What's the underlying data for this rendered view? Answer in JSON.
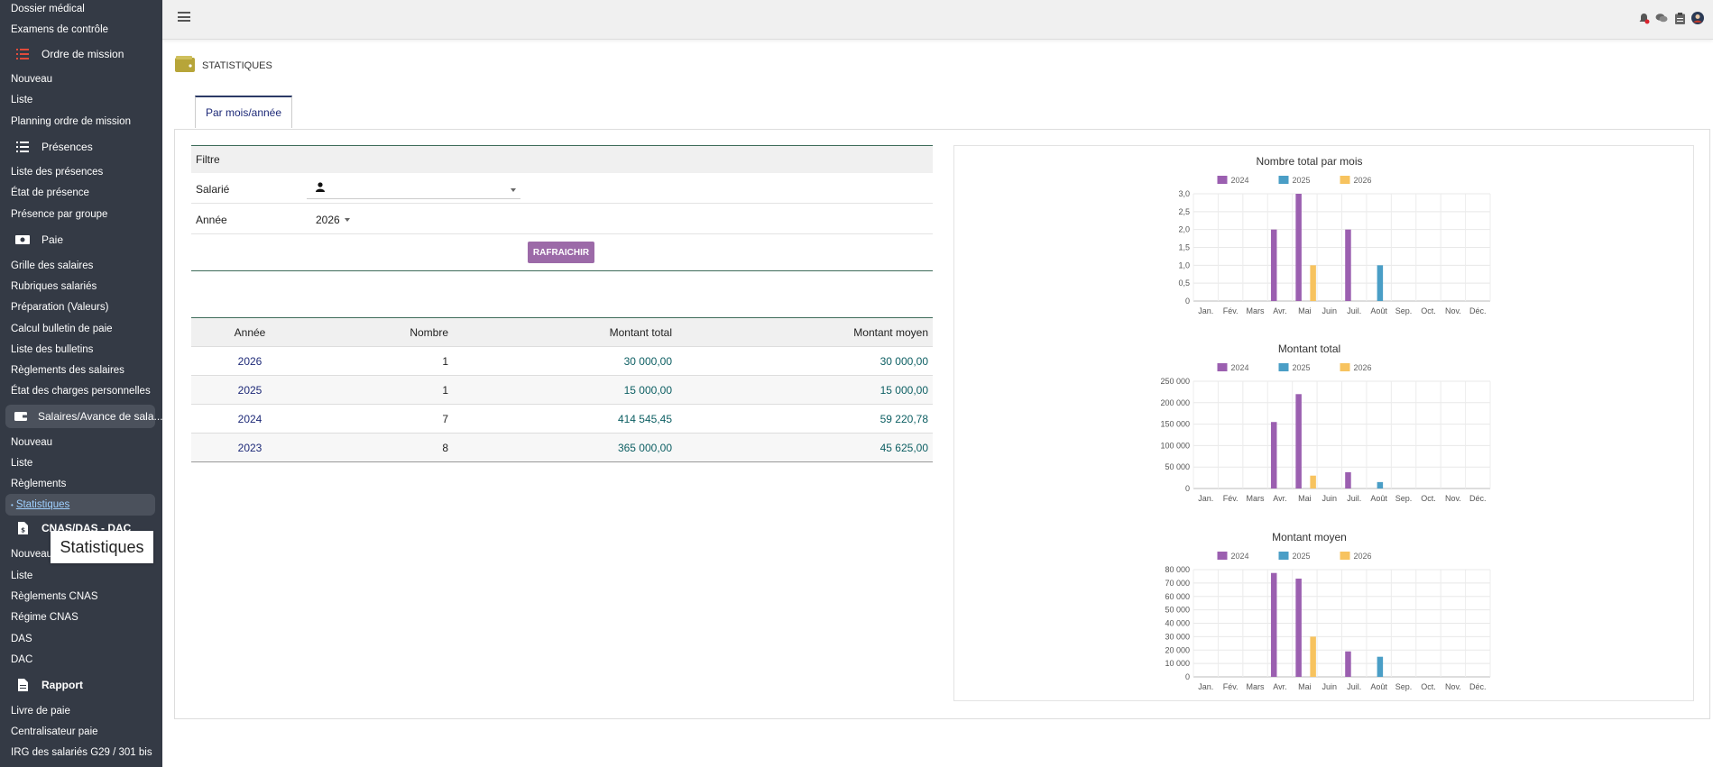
{
  "sidebar": {
    "items": [
      {
        "label": "Dossier médical",
        "type": "item"
      },
      {
        "label": "Examens de contrôle",
        "type": "item"
      },
      {
        "label": "Ordre de mission",
        "type": "section",
        "icon": "list-red-icon"
      },
      {
        "label": "Nouveau",
        "type": "item"
      },
      {
        "label": "Liste",
        "type": "item"
      },
      {
        "label": "Planning ordre de mission",
        "type": "item"
      },
      {
        "label": "Présences",
        "type": "section",
        "icon": "list-icon"
      },
      {
        "label": "Liste des présences",
        "type": "item"
      },
      {
        "label": "État de présence",
        "type": "item"
      },
      {
        "label": "Présence par groupe",
        "type": "item"
      },
      {
        "label": "Paie",
        "type": "section",
        "icon": "money-icon"
      },
      {
        "label": "Grille des salaires",
        "type": "item"
      },
      {
        "label": "Rubriques salariés",
        "type": "item"
      },
      {
        "label": "Préparation (Valeurs)",
        "type": "item"
      },
      {
        "label": "Calcul bulletin de paie",
        "type": "item"
      },
      {
        "label": "Liste des bulletins",
        "type": "item"
      },
      {
        "label": "Règlements des salaires",
        "type": "item"
      },
      {
        "label": "État des charges personnelles",
        "type": "item"
      },
      {
        "label": "Salaires/Avance de sala...",
        "type": "section",
        "icon": "wallet-icon"
      },
      {
        "label": "Nouveau",
        "type": "item"
      },
      {
        "label": "Liste",
        "type": "item"
      },
      {
        "label": "Règlements",
        "type": "item"
      },
      {
        "label": "Statistiques",
        "type": "active"
      },
      {
        "label": "CNAS/DAS - DAC",
        "type": "section",
        "icon": "file-dollar-icon"
      },
      {
        "label": "Nouveau",
        "type": "item"
      },
      {
        "label": "Liste",
        "type": "item"
      },
      {
        "label": "Règlements CNAS",
        "type": "item"
      },
      {
        "label": "Régime CNAS",
        "type": "item"
      },
      {
        "label": "DAS",
        "type": "item"
      },
      {
        "label": "DAC",
        "type": "item"
      },
      {
        "label": "Rapport",
        "type": "section",
        "icon": "file-icon"
      },
      {
        "label": "Livre de paie",
        "type": "item"
      },
      {
        "label": "Centralisateur paie",
        "type": "item"
      },
      {
        "label": "IRG des salariés G29 / 301 bis",
        "type": "item"
      }
    ],
    "tooltip": "Statistiques"
  },
  "header": {
    "icons": [
      "bell-icon",
      "chat-icon",
      "clipboard-icon",
      "user-avatar-icon"
    ]
  },
  "page": {
    "title": "STATISTIQUES",
    "tab": "Par mois/année"
  },
  "filter": {
    "title": "Filtre",
    "employee_label": "Salarié",
    "employee_value": "",
    "year_label": "Année",
    "year_value": "2026",
    "refresh_label": "RAFRAICHIR"
  },
  "table": {
    "headers": [
      "Année",
      "Nombre",
      "Montant total",
      "Montant moyen"
    ],
    "rows": [
      [
        "2026",
        "1",
        "30 000,00",
        "30 000,00"
      ],
      [
        "2025",
        "1",
        "15 000,00",
        "15 000,00"
      ],
      [
        "2024",
        "7",
        "414 545,45",
        "59 220,78"
      ],
      [
        "2023",
        "8",
        "365 000,00",
        "45 625,00"
      ]
    ]
  },
  "chart_data": [
    {
      "type": "bar",
      "title": "Nombre total par mois",
      "categories": [
        "Jan.",
        "Fév.",
        "Mars",
        "Avr.",
        "Mai",
        "Juin",
        "Juil.",
        "Août",
        "Sep.",
        "Oct.",
        "Nov.",
        "Déc."
      ],
      "series": [
        {
          "name": "2024",
          "color": "#9b5fb0",
          "values": [
            0,
            0,
            0,
            2,
            3,
            0,
            2,
            0,
            0,
            0,
            0,
            0
          ]
        },
        {
          "name": "2025",
          "color": "#4a9ec6",
          "values": [
            0,
            0,
            0,
            0,
            0,
            0,
            0,
            1,
            0,
            0,
            0,
            0
          ]
        },
        {
          "name": "2026",
          "color": "#f7c35f",
          "values": [
            0,
            0,
            0,
            0,
            1,
            0,
            0,
            0,
            0,
            0,
            0,
            0
          ]
        }
      ],
      "yticks": [
        "0",
        "0,5",
        "1,0",
        "1,5",
        "2,0",
        "2,5",
        "3,0"
      ],
      "ylim": [
        0,
        3
      ],
      "legend": "top",
      "grid": true
    },
    {
      "type": "bar",
      "title": "Montant total",
      "categories": [
        "Jan.",
        "Fév.",
        "Mars",
        "Avr.",
        "Mai",
        "Juin",
        "Juil.",
        "Août",
        "Sep.",
        "Oct.",
        "Nov.",
        "Déc."
      ],
      "series": [
        {
          "name": "2024",
          "color": "#9b5fb0",
          "values": [
            0,
            0,
            0,
            155000,
            220000,
            0,
            38000,
            0,
            0,
            0,
            0,
            0
          ]
        },
        {
          "name": "2025",
          "color": "#4a9ec6",
          "values": [
            0,
            0,
            0,
            0,
            0,
            0,
            0,
            15000,
            0,
            0,
            0,
            0
          ]
        },
        {
          "name": "2026",
          "color": "#f7c35f",
          "values": [
            0,
            0,
            0,
            0,
            30000,
            0,
            0,
            0,
            0,
            0,
            0,
            0
          ]
        }
      ],
      "yticks": [
        "0",
        "50 000",
        "100 000",
        "150 000",
        "200 000",
        "250 000"
      ],
      "ylim": [
        0,
        250000
      ],
      "legend": "top",
      "grid": true
    },
    {
      "type": "bar",
      "title": "Montant moyen",
      "categories": [
        "Jan.",
        "Fév.",
        "Mars",
        "Avr.",
        "Mai",
        "Juin",
        "Juil.",
        "Août",
        "Sep.",
        "Oct.",
        "Nov.",
        "Déc."
      ],
      "series": [
        {
          "name": "2024",
          "color": "#9b5fb0",
          "values": [
            0,
            0,
            0,
            77500,
            73300,
            0,
            19000,
            0,
            0,
            0,
            0,
            0
          ]
        },
        {
          "name": "2025",
          "color": "#4a9ec6",
          "values": [
            0,
            0,
            0,
            0,
            0,
            0,
            0,
            15000,
            0,
            0,
            0,
            0
          ]
        },
        {
          "name": "2026",
          "color": "#f7c35f",
          "values": [
            0,
            0,
            0,
            0,
            30000,
            0,
            0,
            0,
            0,
            0,
            0,
            0
          ]
        }
      ],
      "yticks": [
        "0",
        "10 000",
        "20 000",
        "30 000",
        "40 000",
        "50 000",
        "60 000",
        "70 000",
        "80 000"
      ],
      "ylim": [
        0,
        80000
      ],
      "legend": "top",
      "grid": true
    }
  ]
}
